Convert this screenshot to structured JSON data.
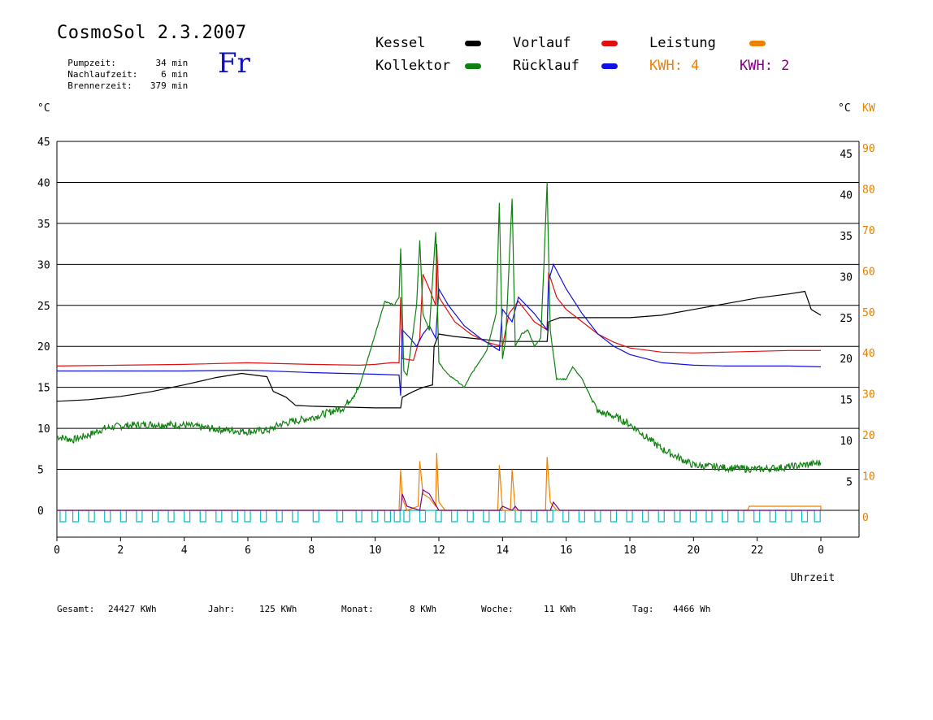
{
  "header": {
    "title": "CosmoSol 2.3.2007",
    "day": "Fr",
    "stats": [
      {
        "label": "Pumpzeit:",
        "value": "34 min"
      },
      {
        "label": "Nachlaufzeit:",
        "value": "6 min"
      },
      {
        "label": "Brennerzeit:",
        "value": "379 min"
      }
    ]
  },
  "legend": {
    "kessel": {
      "label": "Kessel",
      "color": "#000000"
    },
    "vorlauf": {
      "label": "Vorlauf",
      "color": "#e01010"
    },
    "leistung": {
      "label": "Leistung",
      "color": "#f08000"
    },
    "kollektor": {
      "label": "Kollektor",
      "color": "#108010"
    },
    "ruecklauf": {
      "label": "Rücklauf",
      "color": "#1010e0"
    },
    "kwh4": {
      "label": "KWH: 4",
      "color": "#f08000"
    },
    "kwh2": {
      "label": "KWH: 2",
      "color": "#800080"
    }
  },
  "footer": {
    "gesamt_label": "Gesamt:",
    "gesamt_value": "24427 KWh",
    "jahr_label": "Jahr:",
    "jahr_value": "125 KWh",
    "monat_label": "Monat:",
    "monat_value": "8 KWh",
    "woche_label": "Woche:",
    "woche_value": "11 KWh",
    "tag_label": "Tag:",
    "tag_value": "4466 Wh"
  },
  "chart_data": {
    "type": "line",
    "xlabel": "Uhrzeit",
    "ylabel_left": "°C",
    "ylabel_right": "°C",
    "ylabel_right2": "KW",
    "xlim": [
      0,
      24
    ],
    "ylim": [
      0,
      45
    ],
    "ylim_kw": [
      0,
      90
    ],
    "x_ticks": [
      "0",
      "2",
      "4",
      "6",
      "8",
      "10",
      "12",
      "14",
      "16",
      "18",
      "20",
      "22",
      "0"
    ],
    "y_ticks": [
      "0",
      "5",
      "10",
      "15",
      "20",
      "25",
      "30",
      "35",
      "40",
      "45"
    ],
    "y_ticks_right": [
      "",
      "5",
      "10",
      "15",
      "20",
      "25",
      "30",
      "35",
      "40",
      "45"
    ],
    "kw_ticks": [
      "0",
      "10",
      "20",
      "30",
      "40",
      "50",
      "60",
      "70",
      "80",
      "90"
    ],
    "grid": true,
    "series": [
      {
        "name": "Kessel",
        "color": "#000000",
        "points": [
          [
            0,
            13.3
          ],
          [
            1,
            13.5
          ],
          [
            2,
            13.9
          ],
          [
            3,
            14.5
          ],
          [
            4,
            15.3
          ],
          [
            5,
            16.2
          ],
          [
            5.8,
            16.7
          ],
          [
            6.2,
            16.5
          ],
          [
            6.6,
            16.3
          ],
          [
            6.8,
            14.5
          ],
          [
            7.2,
            13.8
          ],
          [
            7.5,
            12.8
          ],
          [
            8,
            12.7
          ],
          [
            9,
            12.6
          ],
          [
            10,
            12.5
          ],
          [
            10.8,
            12.5
          ],
          [
            10.85,
            13.8
          ],
          [
            11.2,
            14.5
          ],
          [
            11.5,
            15.0
          ],
          [
            11.8,
            15.3
          ],
          [
            11.85,
            20.0
          ],
          [
            12.0,
            21.5
          ],
          [
            12.5,
            21.2
          ],
          [
            13,
            21.0
          ],
          [
            13.5,
            20.8
          ],
          [
            14,
            20.6
          ],
          [
            15,
            20.6
          ],
          [
            15.4,
            20.6
          ],
          [
            15.45,
            23.0
          ],
          [
            15.8,
            23.5
          ],
          [
            17,
            23.5
          ],
          [
            18,
            23.5
          ],
          [
            19,
            23.8
          ],
          [
            20,
            24.5
          ],
          [
            21,
            25.2
          ],
          [
            22,
            25.9
          ],
          [
            23,
            26.4
          ],
          [
            23.5,
            26.7
          ],
          [
            23.7,
            24.5
          ],
          [
            24,
            23.8
          ]
        ]
      },
      {
        "name": "Vorlauf",
        "color": "#e01010",
        "points": [
          [
            0,
            17.6
          ],
          [
            2,
            17.7
          ],
          [
            4,
            17.8
          ],
          [
            6,
            18.0
          ],
          [
            8,
            17.8
          ],
          [
            9.5,
            17.7
          ],
          [
            10,
            17.8
          ],
          [
            10.5,
            18.0
          ],
          [
            10.75,
            18.0
          ],
          [
            10.8,
            26.0
          ],
          [
            10.85,
            18.5
          ],
          [
            11.2,
            18.3
          ],
          [
            11.4,
            21.0
          ],
          [
            11.5,
            28.8
          ],
          [
            11.7,
            27.0
          ],
          [
            11.9,
            25.0
          ],
          [
            11.93,
            32.5
          ],
          [
            12.0,
            26.0
          ],
          [
            12.5,
            23.0
          ],
          [
            13,
            21.5
          ],
          [
            13.5,
            20.5
          ],
          [
            14,
            20.0
          ],
          [
            14.2,
            24.0
          ],
          [
            14.5,
            25.5
          ],
          [
            15,
            23.0
          ],
          [
            15.4,
            22.0
          ],
          [
            15.45,
            29.0
          ],
          [
            15.7,
            26.0
          ],
          [
            16,
            24.5
          ],
          [
            16.5,
            23.0
          ],
          [
            17,
            21.5
          ],
          [
            17.5,
            20.5
          ],
          [
            18,
            19.8
          ],
          [
            19,
            19.3
          ],
          [
            20,
            19.2
          ],
          [
            21,
            19.3
          ],
          [
            22,
            19.4
          ],
          [
            23,
            19.5
          ],
          [
            24,
            19.5
          ]
        ]
      },
      {
        "name": "Rücklauf",
        "color": "#1010e0",
        "points": [
          [
            0,
            17.0
          ],
          [
            2,
            17.0
          ],
          [
            4,
            17.0
          ],
          [
            6,
            17.1
          ],
          [
            8,
            16.8
          ],
          [
            10,
            16.6
          ],
          [
            10.75,
            16.5
          ],
          [
            10.8,
            14.0
          ],
          [
            10.85,
            22.0
          ],
          [
            11.1,
            21.0
          ],
          [
            11.3,
            20.0
          ],
          [
            11.5,
            21.5
          ],
          [
            11.7,
            22.5
          ],
          [
            11.9,
            21.0
          ],
          [
            12.0,
            27.0
          ],
          [
            12.3,
            25.0
          ],
          [
            12.8,
            22.5
          ],
          [
            13.3,
            21.0
          ],
          [
            13.9,
            19.5
          ],
          [
            14.0,
            24.5
          ],
          [
            14.3,
            23.0
          ],
          [
            14.5,
            26.0
          ],
          [
            15,
            24.0
          ],
          [
            15.4,
            22.0
          ],
          [
            15.45,
            28.0
          ],
          [
            15.6,
            30.0
          ],
          [
            16,
            27.0
          ],
          [
            16.5,
            24.0
          ],
          [
            17,
            21.5
          ],
          [
            17.5,
            20.0
          ],
          [
            18,
            19.0
          ],
          [
            19,
            18.0
          ],
          [
            20,
            17.7
          ],
          [
            21,
            17.6
          ],
          [
            22,
            17.6
          ],
          [
            23,
            17.6
          ],
          [
            24,
            17.5
          ]
        ]
      },
      {
        "name": "Kollektor",
        "color": "#108010",
        "noisy": true,
        "points": [
          [
            0,
            9.0
          ],
          [
            0.5,
            8.6
          ],
          [
            1.0,
            9.2
          ],
          [
            1.5,
            10.0
          ],
          [
            2,
            10.3
          ],
          [
            3,
            10.5
          ],
          [
            4,
            10.4
          ],
          [
            5,
            9.9
          ],
          [
            6,
            9.6
          ],
          [
            6.7,
            9.8
          ],
          [
            7,
            10.5
          ],
          [
            8,
            11.3
          ],
          [
            9,
            12.5
          ],
          [
            9.5,
            15.0
          ],
          [
            10,
            21.5
          ],
          [
            10.3,
            25.5
          ],
          [
            10.6,
            25.0
          ],
          [
            10.75,
            26.0
          ],
          [
            10.8,
            32.0
          ],
          [
            10.9,
            17.0
          ],
          [
            11.0,
            16.5
          ],
          [
            11.2,
            22.0
          ],
          [
            11.3,
            25.0
          ],
          [
            11.4,
            33.0
          ],
          [
            11.5,
            24.0
          ],
          [
            11.7,
            22.0
          ],
          [
            11.9,
            34.0
          ],
          [
            12.0,
            18.0
          ],
          [
            12.3,
            16.5
          ],
          [
            12.5,
            16.0
          ],
          [
            12.8,
            15.0
          ],
          [
            13.0,
            16.5
          ],
          [
            13.5,
            19.5
          ],
          [
            13.8,
            24.0
          ],
          [
            13.9,
            37.5
          ],
          [
            14.0,
            18.5
          ],
          [
            14.1,
            21.0
          ],
          [
            14.3,
            38.0
          ],
          [
            14.4,
            20.0
          ],
          [
            14.6,
            21.5
          ],
          [
            14.8,
            22.0
          ],
          [
            15.0,
            20.0
          ],
          [
            15.2,
            21.0
          ],
          [
            15.3,
            30.0
          ],
          [
            15.4,
            40.0
          ],
          [
            15.5,
            22.0
          ],
          [
            15.7,
            16.0
          ],
          [
            16,
            16.0
          ],
          [
            16.2,
            17.5
          ],
          [
            16.5,
            16.0
          ],
          [
            17,
            12.0
          ],
          [
            17.5,
            11.5
          ],
          [
            18,
            10.5
          ],
          [
            18.5,
            9.0
          ],
          [
            19,
            7.5
          ],
          [
            19.5,
            6.5
          ],
          [
            20,
            5.5
          ],
          [
            21,
            5.2
          ],
          [
            22,
            5.0
          ],
          [
            23,
            5.3
          ],
          [
            24,
            5.8
          ]
        ]
      },
      {
        "name": "Leistung",
        "color": "#f08000",
        "axis": "kw",
        "points": [
          [
            0,
            0
          ],
          [
            10.75,
            0
          ],
          [
            10.8,
            10
          ],
          [
            10.85,
            3
          ],
          [
            11.0,
            0
          ],
          [
            11.35,
            1
          ],
          [
            11.4,
            12
          ],
          [
            11.5,
            4
          ],
          [
            11.7,
            3
          ],
          [
            11.9,
            1
          ],
          [
            11.93,
            14
          ],
          [
            12.0,
            2
          ],
          [
            12.2,
            0
          ],
          [
            13.85,
            0
          ],
          [
            13.9,
            11
          ],
          [
            14.0,
            0
          ],
          [
            14.25,
            0
          ],
          [
            14.3,
            10
          ],
          [
            14.4,
            0
          ],
          [
            15.35,
            0
          ],
          [
            15.4,
            13
          ],
          [
            15.5,
            2
          ],
          [
            15.7,
            0
          ],
          [
            21.7,
            0
          ],
          [
            21.75,
            1
          ],
          [
            24,
            1
          ],
          [
            24,
            0
          ]
        ]
      },
      {
        "name": "KWH",
        "color": "#800080",
        "axis": "kw",
        "points": [
          [
            0,
            0
          ],
          [
            10.8,
            0
          ],
          [
            10.85,
            4
          ],
          [
            11.0,
            1
          ],
          [
            11.4,
            0
          ],
          [
            11.5,
            5
          ],
          [
            11.7,
            4
          ],
          [
            12.0,
            0
          ],
          [
            13.9,
            0
          ],
          [
            14.0,
            1
          ],
          [
            14.3,
            0
          ],
          [
            14.4,
            1
          ],
          [
            14.5,
            0
          ],
          [
            15.5,
            0
          ],
          [
            15.6,
            2
          ],
          [
            15.8,
            0
          ],
          [
            24,
            0
          ]
        ]
      }
    ],
    "pump_pulses": [
      0.1,
      0.5,
      1.0,
      1.5,
      2.0,
      2.5,
      3.0,
      3.5,
      4.0,
      4.5,
      5.0,
      5.5,
      5.9,
      6.4,
      6.9,
      7.4,
      8.05,
      8.8,
      9.4,
      9.9,
      10.3,
      10.6,
      10.9,
      11.4,
      11.9,
      12.4,
      12.9,
      13.4,
      13.9,
      14.4,
      14.9,
      15.4,
      15.9,
      16.4,
      16.9,
      17.4,
      17.9,
      18.4,
      18.9,
      19.4,
      19.9,
      20.4,
      20.9,
      21.4,
      21.9,
      22.4,
      22.9,
      23.4,
      23.8
    ],
    "pump_color": "#00c0c0"
  }
}
